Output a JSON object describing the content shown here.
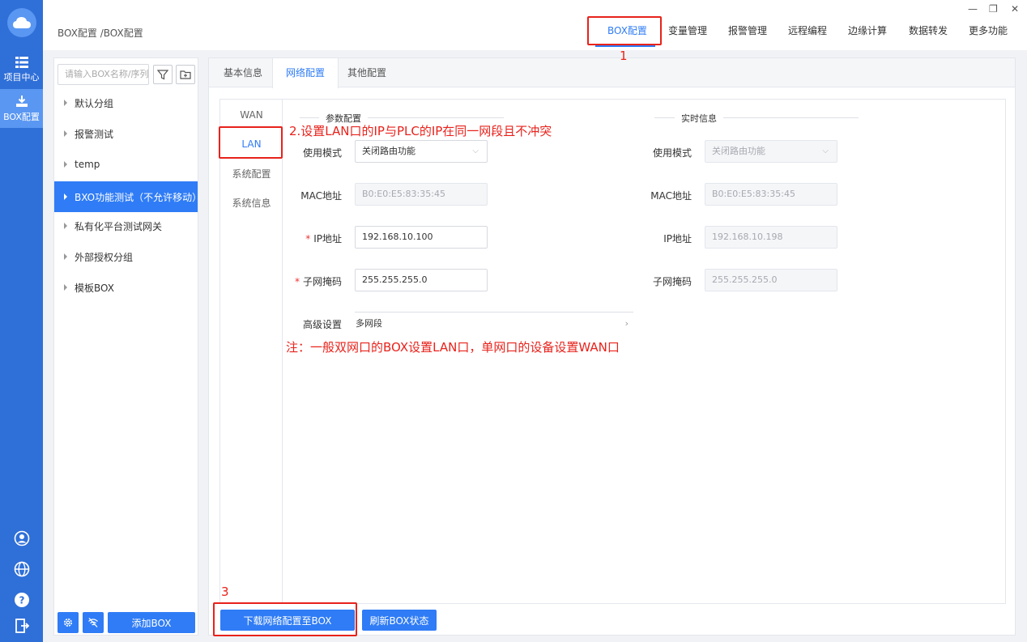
{
  "rail": {
    "items": [
      {
        "label": "项目中心"
      },
      {
        "label": "BOX配置"
      }
    ]
  },
  "header": {
    "breadcrumb": "BOX配置 /BOX配置",
    "menu": [
      "BOX配置",
      "变量管理",
      "报警管理",
      "远程编程",
      "边缘计算",
      "数据转发",
      "更多功能"
    ],
    "active_menu": "BOX配置",
    "window_controls": {
      "minimize": "—",
      "restore": "❐",
      "close": "✕"
    }
  },
  "left_panel": {
    "search_placeholder": "请输入BOX名称/序列",
    "groups": [
      "默认分组",
      "报警测试",
      "temp",
      "BXO功能测试（不允许移动）",
      "私有化平台测试网关",
      "外部授权分组",
      "模板BOX"
    ],
    "active_group": "BXO功能测试（不允许移动）",
    "add_box_label": "添加BOX"
  },
  "main": {
    "tabs": [
      "基本信息",
      "网络配置",
      "其他配置"
    ],
    "active_tab": "网络配置",
    "subnav": [
      "WAN",
      "LAN",
      "系统配置",
      "系统信息"
    ],
    "active_subnav": "LAN",
    "params_title": "参数配置",
    "realtime_title": "实时信息",
    "params": {
      "mode_label": "使用模式",
      "mode_value": "关闭路由功能",
      "mac_label": "MAC地址",
      "mac_value": "B0:E0:E5:83:35:45",
      "ip_label": "IP地址",
      "ip_value": "192.168.10.100",
      "mask_label": "子网掩码",
      "mask_value": "255.255.255.0",
      "advanced_label": "高级设置",
      "advanced_value": "多网段"
    },
    "realtime": {
      "mode_label": "使用模式",
      "mode_value": "关闭路由功能",
      "mac_label": "MAC地址",
      "mac_value": "B0:E0:E5:83:35:45",
      "ip_label": "IP地址",
      "ip_value": "192.168.10.198",
      "mask_label": "子网掩码",
      "mask_value": "255.255.255.0"
    },
    "download_button": "下载网络配置至BOX",
    "refresh_button": "刷新BOX状态"
  },
  "annotations": {
    "step1": "1",
    "step2": "2.设置LAN口的IP与PLC的IP在同一网段且不冲突",
    "note": "注：一般双网口的BOX设置LAN口，单网口的设备设置WAN口",
    "step3": "3",
    "color": "#e8221b"
  },
  "colors": {
    "accent": "#2f7cf6",
    "rail": "#2f6fd8"
  }
}
